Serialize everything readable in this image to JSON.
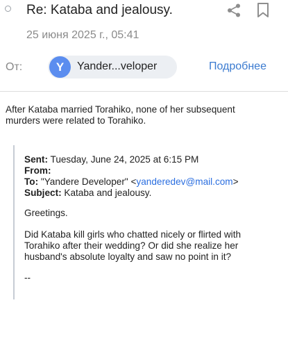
{
  "header": {
    "subject": "Re: Kataba and jealousy.",
    "date": "25 июня 2025 г., 05:41",
    "from_label": "От:",
    "sender": {
      "avatar_letter": "Y",
      "name": "Yander...veloper",
      "avatar_color": "#5b8def"
    },
    "details_link": "Подробнее",
    "icons": {
      "share": "share-icon",
      "bookmark": "bookmark-icon"
    }
  },
  "message": {
    "body": "After Kataba married Torahiko, none of her subsequent murders were related to Torahiko."
  },
  "quoted": {
    "sent_label": "Sent:",
    "sent_value": " Tuesday, June 24, 2025 at 6:15 PM",
    "from_label": "From:",
    "to_label": "To:",
    "to_name": " \"Yandere Developer\" <",
    "to_email": "yanderedev@mail.com",
    "to_close": ">",
    "subject_label": "Subject:",
    "subject_value": " Kataba and jealousy.",
    "greeting": "Greetings.",
    "question": "Did Kataba kill girls who chatted nicely or flirted with Torahiko after their wedding? Or did she realize her husband's absolute loyalty and saw no point in it?",
    "signature": "--"
  },
  "colors": {
    "link": "#3b7bd0",
    "email_link": "#2a6ee0",
    "quote_border": "#c6ccd4"
  }
}
